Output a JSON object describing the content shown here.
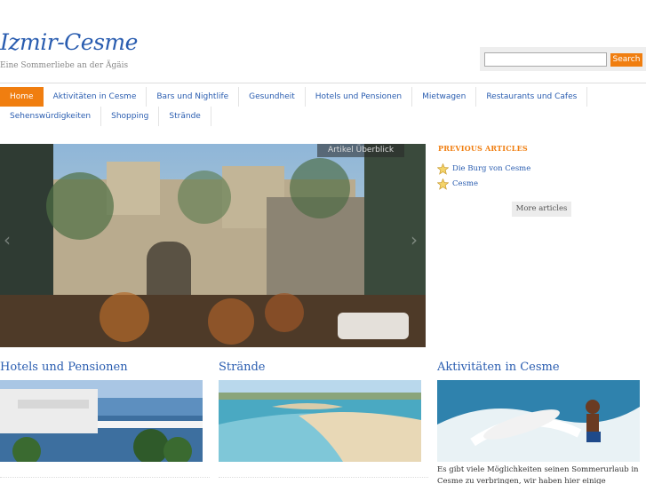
{
  "site": {
    "title": "Izmir-Cesme",
    "tagline": "Eine Sommerliebe an der Ägäis"
  },
  "search": {
    "placeholder": "",
    "button_label": "Search"
  },
  "nav": {
    "row1": [
      "Home",
      "Aktivitäten in Cesme",
      "Bars und Nightlife",
      "Gesundheit",
      "Hotels und Pensionen",
      "Mietwagen",
      "Restaurants und Cafes"
    ],
    "row2": [
      "Sehenswürdigkeiten",
      "Shopping",
      "Strände"
    ],
    "active": "Home"
  },
  "hero": {
    "caption": "Artikel Überblick",
    "prev_glyph": "‹",
    "next_glyph": "›"
  },
  "previous_articles": {
    "title": "PREVIOUS ARTICLES",
    "items": [
      "Die Burg von Cesme",
      "Cesme"
    ],
    "more_label": "More articles"
  },
  "sections": [
    {
      "title": "Hotels und Pensionen"
    },
    {
      "title": "Strände"
    },
    {
      "title": "Aktivitäten in Cesme",
      "text": "Es gibt viele Möglichkeiten seinen Sommerurlaub in Cesme zu verbringen, wir haben hier einige"
    }
  ],
  "colors": {
    "accent": "#f07e10",
    "link": "#2a5db0"
  }
}
